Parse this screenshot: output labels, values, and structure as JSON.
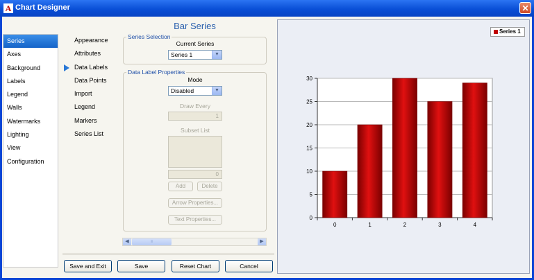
{
  "window": {
    "title": "Chart Designer",
    "close_glyph": "✕",
    "app_icon": "A"
  },
  "nav": {
    "items": [
      {
        "label": "Series",
        "active": true
      },
      {
        "label": "Axes"
      },
      {
        "label": "Background"
      },
      {
        "label": "Labels"
      },
      {
        "label": "Legend"
      },
      {
        "label": "Walls"
      },
      {
        "label": "Watermarks"
      },
      {
        "label": "Lighting"
      },
      {
        "label": "View"
      },
      {
        "label": "Configuration"
      }
    ]
  },
  "subnav": {
    "items": [
      {
        "label": "Appearance"
      },
      {
        "label": "Attributes"
      },
      {
        "label": "Data Labels",
        "active": true
      },
      {
        "label": "Data Points"
      },
      {
        "label": "Import"
      },
      {
        "label": "Legend"
      },
      {
        "label": "Markers"
      },
      {
        "label": "Series List"
      }
    ]
  },
  "panel": {
    "title": "Bar Series",
    "series_selection": {
      "legend": "Series Selection",
      "current_series_label": "Current Series",
      "current_series_value": "Series 1"
    },
    "data_label_properties": {
      "legend": "Data Label Properties",
      "mode_label": "Mode",
      "mode_value": "Disabled",
      "draw_every_label": "Draw Every",
      "draw_every_value": "1",
      "subset_list_label": "Subset List",
      "subset_count_value": "0",
      "add_label": "Add",
      "delete_label": "Delete",
      "arrow_properties_label": "Arrow Properties...",
      "text_properties_label": "Text Properties..."
    }
  },
  "footer": {
    "save_exit_label": "Save and Exit",
    "save_label": "Save",
    "reset_label": "Reset Chart",
    "cancel_label": "Cancel"
  },
  "icons": {
    "dropdown": "chevron-down-icon",
    "scroll_left": "arrow-left-icon",
    "scroll_right": "arrow-right-icon",
    "selection_arrow": "triangle-right-icon"
  },
  "colors": {
    "bar": "#c00000",
    "bar_light": "#e01010",
    "bar_dark": "#7a0000",
    "accent": "#2a78d6"
  },
  "chart_data": {
    "type": "bar",
    "categories": [
      "0",
      "1",
      "2",
      "3",
      "4"
    ],
    "series": [
      {
        "name": "Series 1",
        "values": [
          10,
          20,
          30,
          25,
          29
        ]
      }
    ],
    "ylim": [
      0,
      30
    ],
    "yticks": [
      0,
      5,
      10,
      15,
      20,
      25,
      30
    ],
    "grid": true,
    "legend": "top-right"
  }
}
